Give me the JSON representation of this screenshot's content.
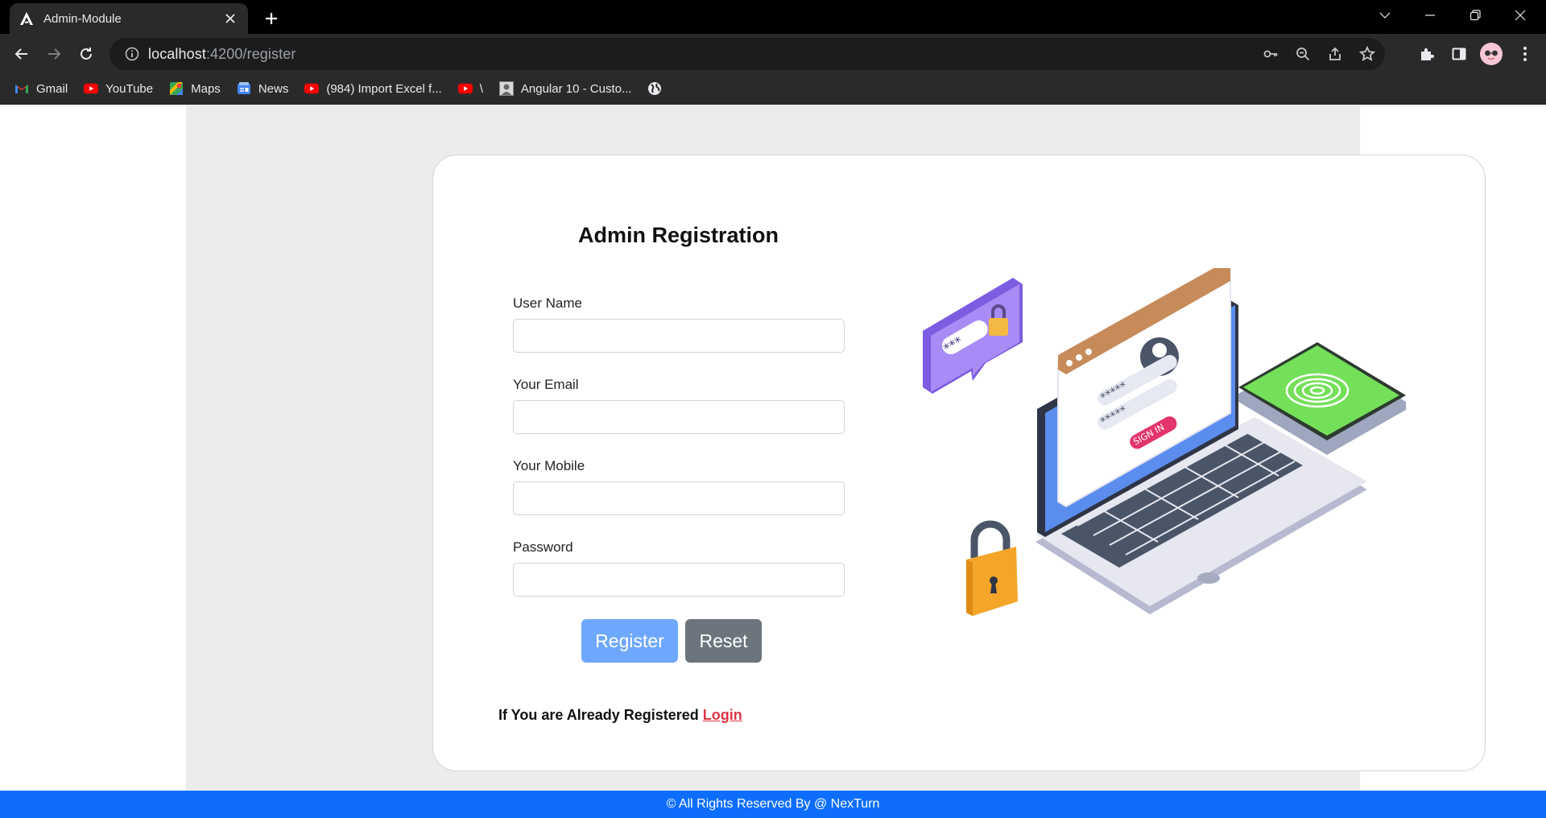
{
  "browser": {
    "tab_title": "Admin-Module",
    "url_host": "localhost",
    "url_path": ":4200/register",
    "bookmarks": [
      {
        "label": "Gmail",
        "icon": "gmail-icon"
      },
      {
        "label": "YouTube",
        "icon": "youtube-icon"
      },
      {
        "label": "Maps",
        "icon": "maps-icon"
      },
      {
        "label": "News",
        "icon": "news-icon"
      },
      {
        "label": "(984) Import Excel f...",
        "icon": "youtube-icon"
      },
      {
        "label": "\\",
        "icon": "youtube-icon"
      },
      {
        "label": "Angular 10 - Custo...",
        "icon": "page-thumbnail-icon"
      },
      {
        "label": "",
        "icon": "globe-icon"
      }
    ]
  },
  "form": {
    "title": "Admin Registration",
    "fields": [
      {
        "label": "User Name",
        "value": "",
        "placeholder": ""
      },
      {
        "label": "Your Email",
        "value": "",
        "placeholder": ""
      },
      {
        "label": "Your Mobile",
        "value": "",
        "placeholder": ""
      },
      {
        "label": "Password",
        "value": "",
        "placeholder": ""
      }
    ],
    "register_label": "Register",
    "reset_label": "Reset",
    "already_text": "If You are Already Registered",
    "login_label": "Login",
    "illustration_label": "SIGN IN"
  },
  "footer": {
    "text": "© All Rights Reserved By @ NexTurn"
  },
  "colors": {
    "footer_bg": "#0d6efd",
    "register_bg": "#6ea8fe",
    "reset_bg": "#6c757d",
    "login_link": "#dc3545",
    "page_bg": "#ececec"
  }
}
